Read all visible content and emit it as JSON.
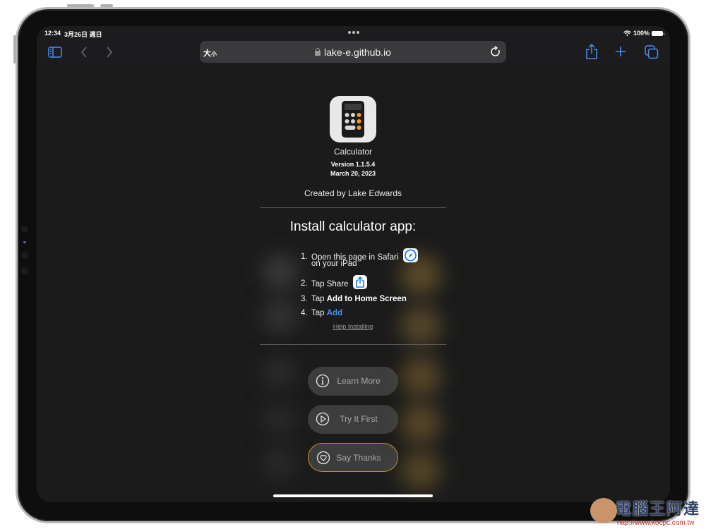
{
  "status_bar": {
    "time": "12:34",
    "date": "3月26日 週日",
    "wifi_icon": "wifi-icon",
    "battery_percent": "100%",
    "battery_level": 1.0
  },
  "toolbar": {
    "sidebar_icon": "sidebar-icon",
    "back_icon": "chevron-left-icon",
    "forward_icon": "chevron-right-icon",
    "text_size_label": "大",
    "text_size_small": "小",
    "url": "lake-e.github.io",
    "lock_icon": "lock-icon",
    "reload_icon": "reload-icon",
    "share_icon": "share-icon",
    "new_tab_icon": "plus-icon",
    "tabs_icon": "tabs-icon",
    "accent_color": "#4a90f0"
  },
  "app": {
    "name": "Calculator",
    "version": "Version 1.1.5.4",
    "date": "March 20, 2023",
    "creator": "Created by Lake Edwards"
  },
  "install": {
    "title": "Install calculator app:",
    "steps": [
      {
        "num": "1.",
        "text": "Open this page in Safari",
        "line2": "on your iPad",
        "icon": "safari-compass-icon"
      },
      {
        "num": "2.",
        "text": "Tap Share",
        "icon": "share-icon"
      },
      {
        "num": "3.",
        "text": "Tap ",
        "bold": "Add to Home Screen"
      },
      {
        "num": "4.",
        "text": "Tap ",
        "link": "Add"
      }
    ],
    "help_link": "Help Installing"
  },
  "buttons": [
    {
      "label": "Learn More",
      "icon": "info-circle-icon"
    },
    {
      "label": "Try It First",
      "icon": "play-circle-icon"
    },
    {
      "label": "Say Thanks",
      "icon": "heart-circle-icon",
      "border_color": "#c48a28"
    }
  ],
  "watermark": {
    "title": "電腦王阿達",
    "url": "http://www.kocpc.com.tw"
  }
}
